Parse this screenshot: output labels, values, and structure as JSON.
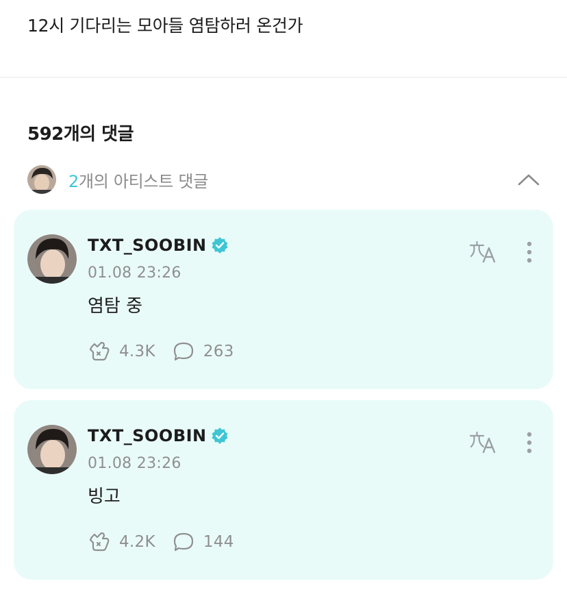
{
  "post": {
    "text": "12시 기다리는 모아들 염탐하러 온건가"
  },
  "comments_section": {
    "count_label": "592개의 댓글",
    "artist_count": "2",
    "artist_label": "개의 아티스트 댓글",
    "collapse_icon": "chevron-up-icon"
  },
  "colors": {
    "accent": "#3fc6d4",
    "card_bg": "#e9fbf9",
    "verified": "#3fc6d4",
    "muted": "#8f8f8f"
  },
  "comments": [
    {
      "username": "TXT_SOOBIN",
      "timestamp": "01.08 23:26",
      "text": "염탐 중",
      "likes": "4.3K",
      "replies": "263"
    },
    {
      "username": "TXT_SOOBIN",
      "timestamp": "01.08 23:26",
      "text": "빙고",
      "likes": "4.2K",
      "replies": "144"
    }
  ]
}
